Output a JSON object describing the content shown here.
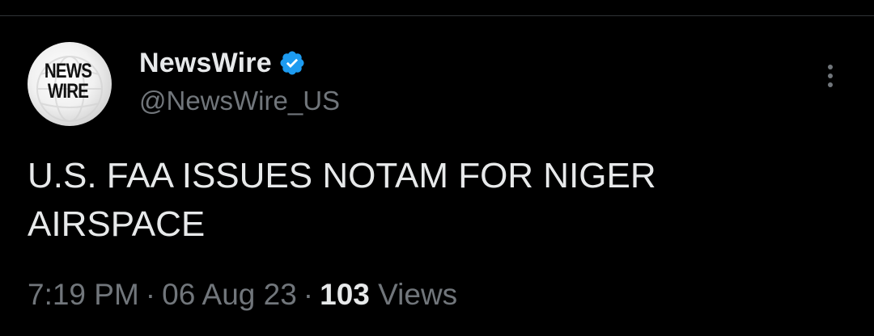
{
  "account": {
    "avatar_line1": "NEWS",
    "avatar_line2": "WIRE",
    "display_name": "NewsWire",
    "handle": "@NewsWire_US",
    "verified_color": "#1d9bf0"
  },
  "post": {
    "text": "U.S. FAA ISSUES NOTAM FOR NIGER AIRSPACE",
    "time": "7:19 PM",
    "separator": "·",
    "date": "06 Aug 23",
    "views_count": "103",
    "views_label": "Views"
  },
  "icons": {
    "verified": "verified-badge-icon",
    "more": "more-options-icon"
  },
  "colors": {
    "background": "#000000",
    "primary_text": "#e7e9ea",
    "secondary_text": "#71767b",
    "divider": "#2f3336"
  }
}
